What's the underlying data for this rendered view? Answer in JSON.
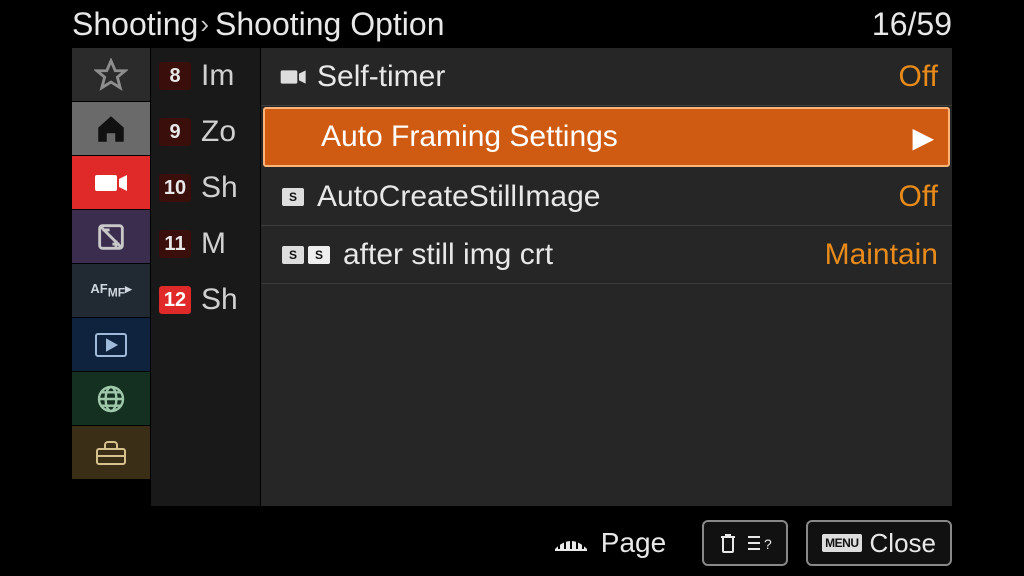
{
  "breadcrumb": {
    "root": "Shooting",
    "leaf": "Shooting Option"
  },
  "page_counter": "16/59",
  "sidebar": {
    "tabs": [
      {
        "name": "favorites-tab"
      },
      {
        "name": "home-tab"
      },
      {
        "name": "movie-tab",
        "active": true
      },
      {
        "name": "exposure-tab"
      },
      {
        "name": "focus-tab"
      },
      {
        "name": "playback-tab"
      },
      {
        "name": "network-tab"
      },
      {
        "name": "setup-tab"
      }
    ]
  },
  "sections": [
    {
      "num": "8",
      "label": "Im",
      "active": false
    },
    {
      "num": "9",
      "label": "Zo",
      "active": false
    },
    {
      "num": "10",
      "label": "Sh",
      "active": false
    },
    {
      "num": "11",
      "label": "M",
      "active": false
    },
    {
      "num": "12",
      "label": "Sh",
      "active": true
    }
  ],
  "rows": [
    {
      "label": "Self-timer",
      "value": "Off",
      "selected": false,
      "has_submenu": false,
      "icon": "movie"
    },
    {
      "label": "Auto Framing Settings",
      "value": "",
      "selected": true,
      "has_submenu": true,
      "icon": "none"
    },
    {
      "label": "AutoCreateStillImage",
      "value": "Off",
      "selected": false,
      "has_submenu": false,
      "icon": "sg"
    },
    {
      "label": "after still img crt",
      "value": "Maintain",
      "selected": false,
      "has_submenu": false,
      "icon": "sg-s"
    }
  ],
  "bottom": {
    "page_label": "Page",
    "help_label": "",
    "close_label": "Close",
    "menu_chip": "MENU"
  },
  "colors": {
    "accent": "#cf5b12",
    "value": "#e88b1a",
    "active_red": "#e02a2a"
  }
}
